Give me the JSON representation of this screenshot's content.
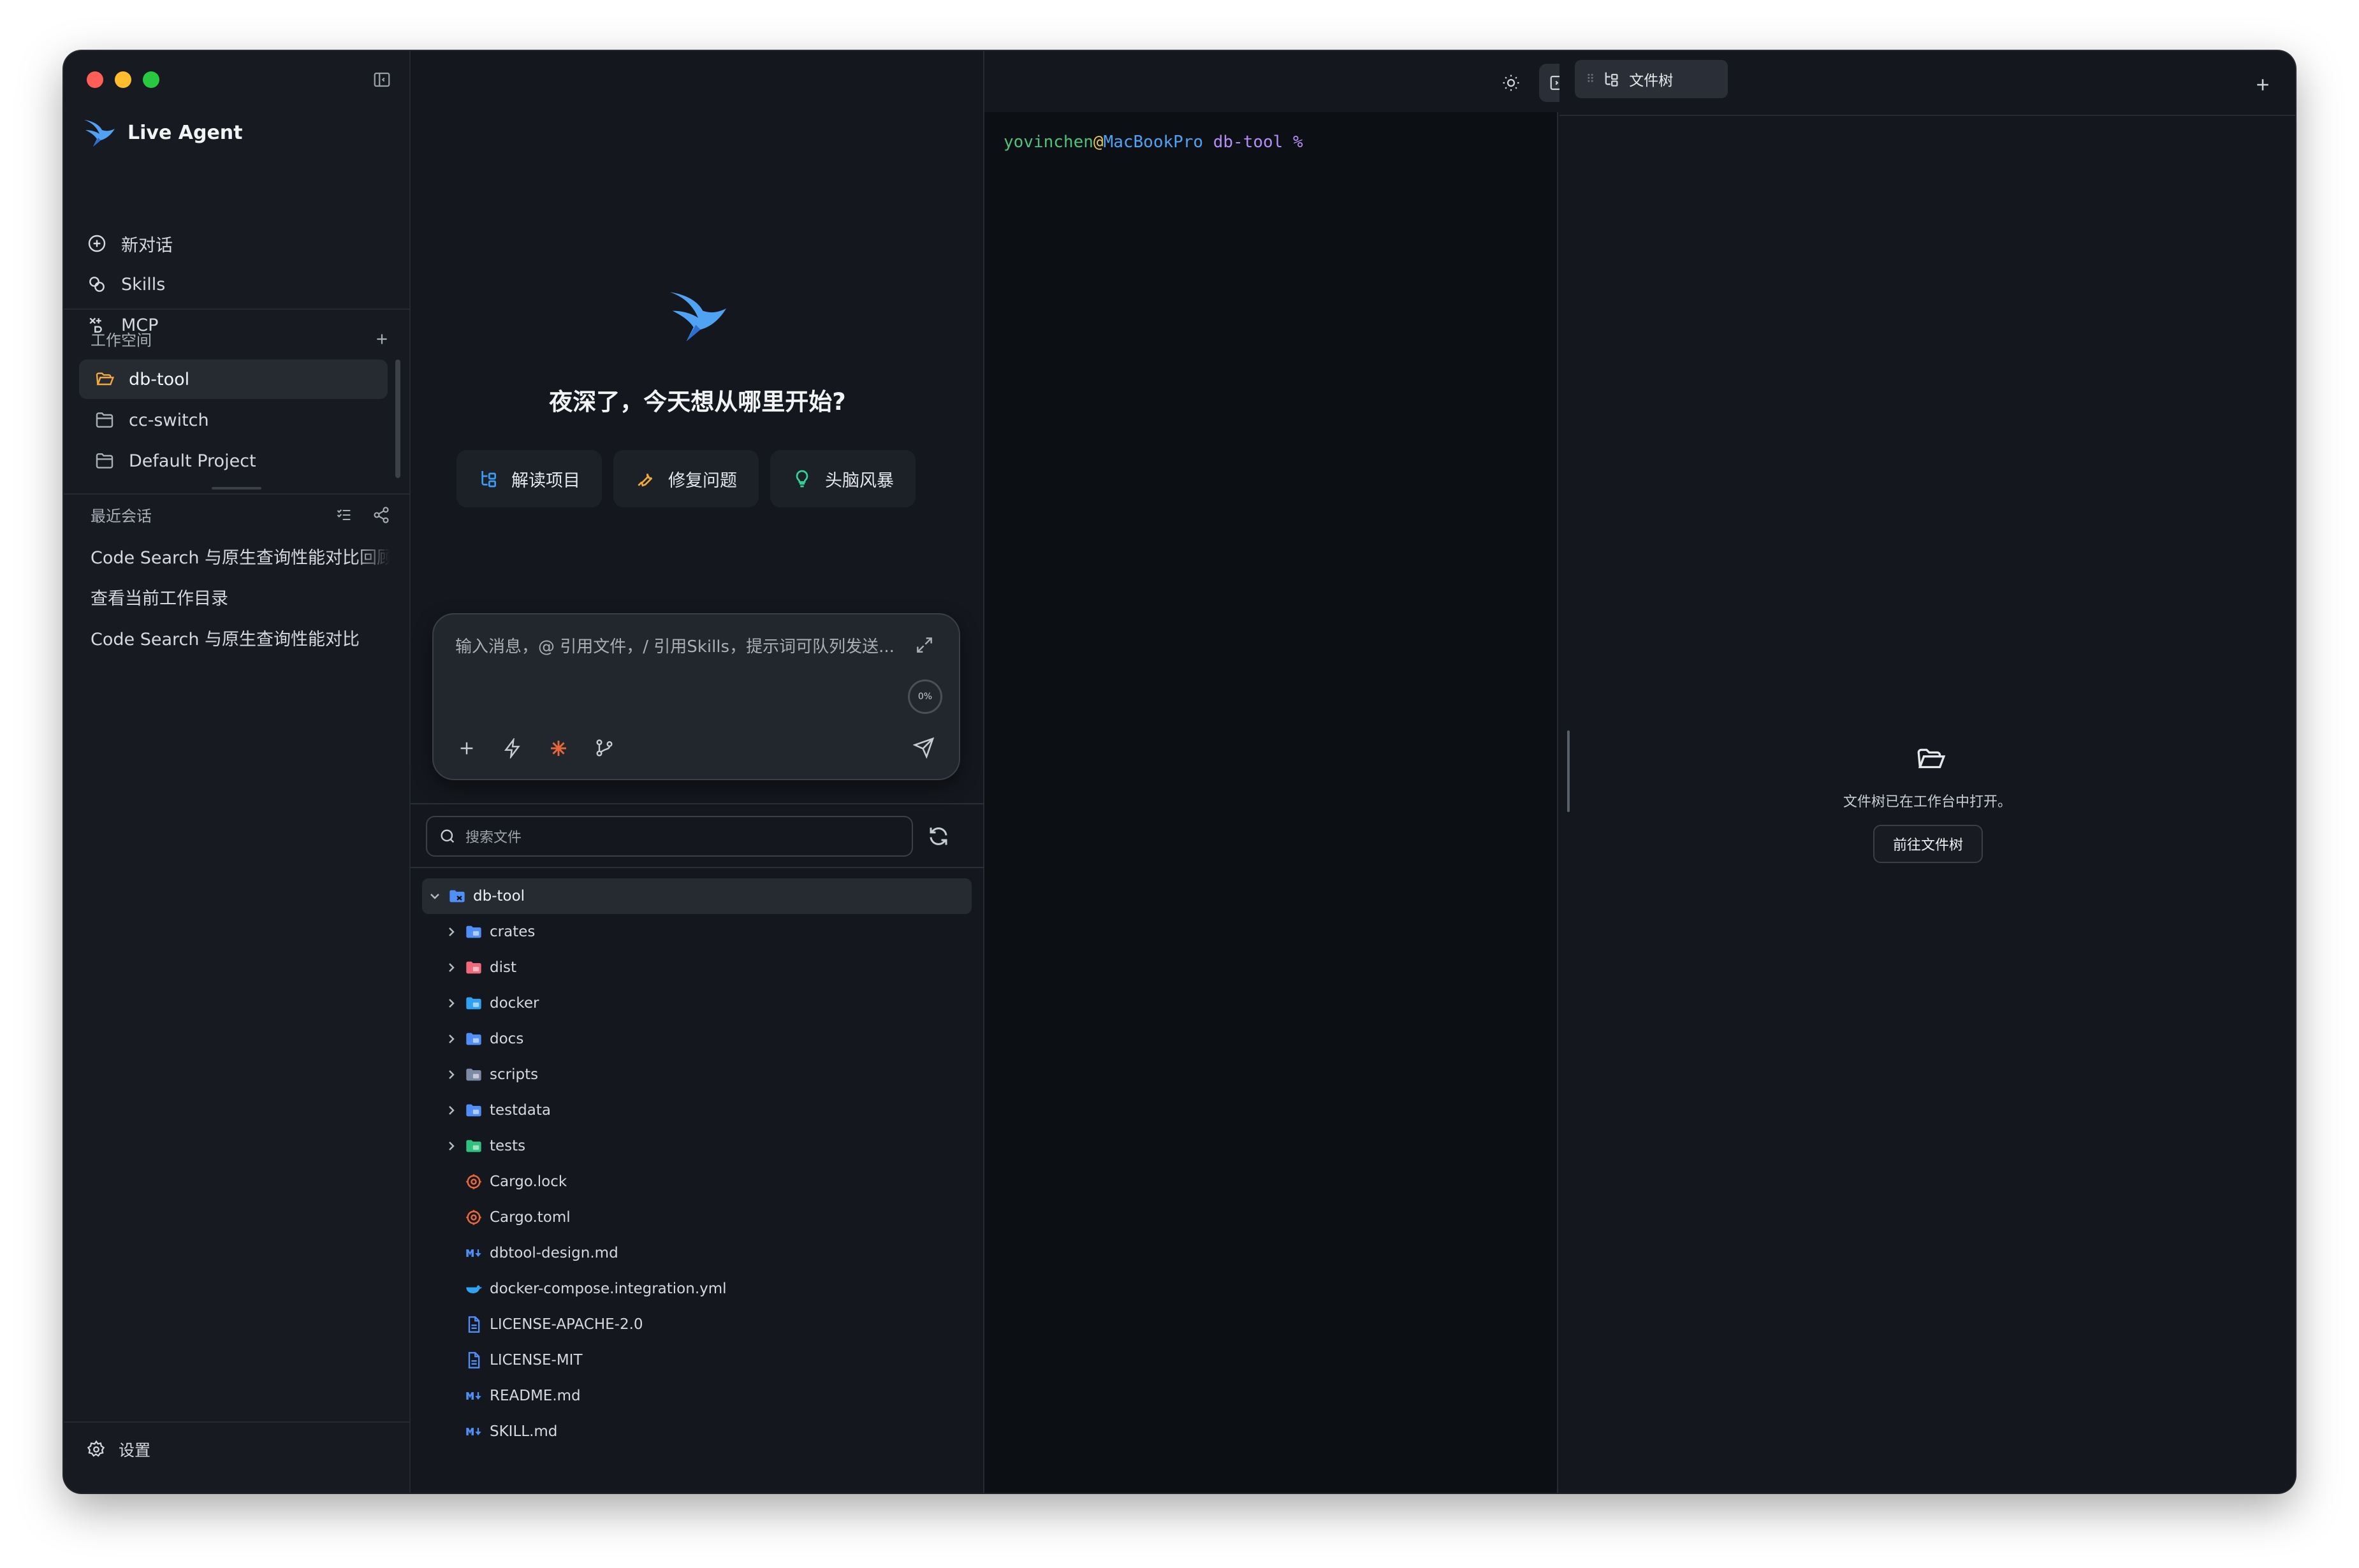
{
  "app": {
    "name": "Live Agent"
  },
  "nav": [
    {
      "label": "新对话",
      "icon": "plus-circle-icon"
    },
    {
      "label": "Skills",
      "icon": "skills-icon"
    },
    {
      "label": "MCP",
      "icon": "mcp-icon"
    }
  ],
  "workspace": {
    "title": "工作空间",
    "items": [
      {
        "label": "db-tool",
        "active": true
      },
      {
        "label": "cc-switch",
        "active": false
      },
      {
        "label": "Default Project",
        "active": false
      }
    ]
  },
  "recent": {
    "title": "最近会话",
    "items": [
      "Code Search 与原生查询性能对比回顾",
      "查看当前工作目录",
      "Code Search 与原生查询性能对比"
    ]
  },
  "settings_label": "设置",
  "chat": {
    "greeting": "夜深了，今天想从哪里开始?",
    "quick_actions": [
      {
        "label": "解读项目",
        "icon": "tree-icon",
        "color": "#3b9cf5"
      },
      {
        "label": "修复问题",
        "icon": "wrench-icon",
        "color": "#f2a93b"
      },
      {
        "label": "头脑风暴",
        "icon": "lightbulb-icon",
        "color": "#34d399"
      }
    ],
    "composer": {
      "placeholder": "输入消息，@ 引用文件，/ 引用Skills，提示词可队列发送...",
      "usage": "0%"
    }
  },
  "files": {
    "search_placeholder": "搜索文件",
    "root": "db-tool",
    "items": [
      {
        "name": "crates",
        "type": "folder",
        "color": "#4f8ff7"
      },
      {
        "name": "dist",
        "type": "folder",
        "color": "#f16a7c"
      },
      {
        "name": "docker",
        "type": "folder",
        "color": "#2fa3f2"
      },
      {
        "name": "docs",
        "type": "folder",
        "color": "#4f8ff7"
      },
      {
        "name": "scripts",
        "type": "folder",
        "color": "#7c8aa5"
      },
      {
        "name": "testdata",
        "type": "folder",
        "color": "#4f8ff7"
      },
      {
        "name": "tests",
        "type": "folder",
        "color": "#2ec27e"
      },
      {
        "name": "Cargo.lock",
        "type": "rust",
        "color": "#e5673a"
      },
      {
        "name": "Cargo.toml",
        "type": "rust",
        "color": "#e5673a"
      },
      {
        "name": "dbtool-design.md",
        "type": "markdown",
        "color": "#4f8ff7"
      },
      {
        "name": "docker-compose.integration.yml",
        "type": "docker",
        "color": "#2fa3f2"
      },
      {
        "name": "LICENSE-APACHE-2.0",
        "type": "doc",
        "color": "#4f8ff7"
      },
      {
        "name": "LICENSE-MIT",
        "type": "doc",
        "color": "#4f8ff7"
      },
      {
        "name": "README.md",
        "type": "markdown",
        "color": "#4f8ff7"
      },
      {
        "name": "SKILL.md",
        "type": "markdown",
        "color": "#4f8ff7"
      }
    ]
  },
  "terminal": {
    "user": "yovinchen",
    "at": "@",
    "host": "MacBookPro",
    "dir": "db-tool",
    "symbol": "%",
    "colors": {
      "user": "#4ec27a",
      "host": "#4fa3f2",
      "dir": "#b68cf5",
      "symbol": "#b68cf5"
    }
  },
  "right_panel": {
    "tab_label": "文件树",
    "empty_message": "文件树已在工作台中打开。",
    "goto_button": "前往文件树"
  },
  "colors": {
    "accent_orange": "#f2a93b",
    "traffic": [
      "#ff5f57",
      "#febc2e",
      "#28c840"
    ]
  }
}
